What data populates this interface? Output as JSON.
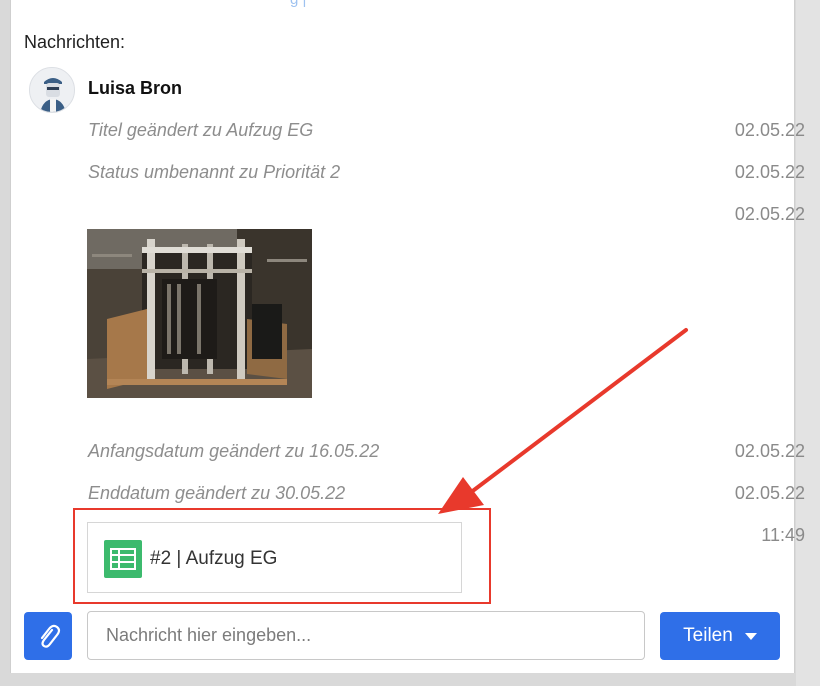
{
  "header_peek": "g |",
  "messages": {
    "heading": "Nachrichten:",
    "author": "Luisa Bron",
    "entries": [
      {
        "text": "Titel geändert zu Aufzug EG",
        "date": "02.05.22"
      },
      {
        "text": "Status umbenannt zu Priorität 2",
        "date": "02.05.22"
      },
      {
        "text": "",
        "date": "02.05.22"
      },
      {
        "text": "Anfangsdatum geändert zu 16.05.22",
        "date": "02.05.22"
      },
      {
        "text": "Enddatum geändert zu 30.05.22",
        "date": "02.05.22"
      },
      {
        "text": "",
        "date": "11:49"
      }
    ],
    "attachment_image": "elevator-construction-photo",
    "linked_item": {
      "label": "#2 | Aufzug EG",
      "icon": "spreadsheet-icon"
    }
  },
  "composer": {
    "attach_icon": "paperclip-icon",
    "input_placeholder": "Nachricht hier eingeben...",
    "input_value": "",
    "share_label": "Teilen",
    "share_icon": "caret-down-icon"
  },
  "colors": {
    "primary": "#2f6fe8",
    "highlight": "#e8392c",
    "sheet_green": "#3cba6d"
  }
}
